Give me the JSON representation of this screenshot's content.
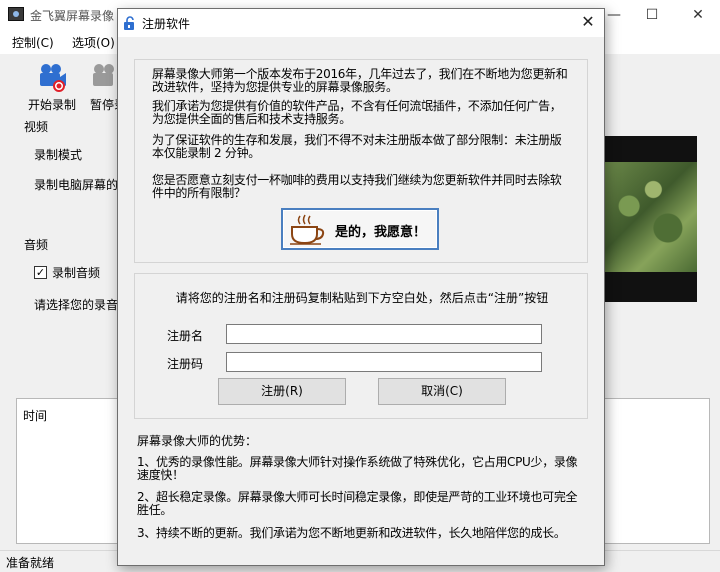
{
  "main_window": {
    "title": "金飞翼屏幕录像",
    "controls": {
      "minimize": "—",
      "maximize": "☐",
      "close": "✕"
    },
    "menu": [
      "控制(C)",
      "选项(O)"
    ],
    "toolbar": [
      {
        "label": "开始录制",
        "icon": "camera-record-icon"
      },
      {
        "label": "暂停录",
        "icon": "camera-pause-icon"
      }
    ],
    "video_section": "视频",
    "record_mode_label": "录制模式",
    "record_screen_label": "录制电脑屏幕的",
    "audio_section": "音频",
    "record_audio_label": "录制音频",
    "record_audio_checked": true,
    "select_audio_label": "请选择您的录音",
    "log_header": "时间",
    "status": "准备就绪"
  },
  "dialog": {
    "title": "注册软件",
    "close": "✕",
    "info": [
      "屏幕录像大师第一个版本发布于2016年，几年过去了，我们在不断地为您更新和改进软件，坚持为您提供专业的屏幕录像服务。",
      "我们承诺为您提供有价值的软件产品，不含有任何流氓插件，不添加任何广告，为您提供全面的售后和技术支持服务。",
      "为了保证软件的生存和发展，我们不得不对未注册版本做了部分限制：未注册版本仅能录制 2 分钟。",
      "您是否愿意立刻支付一杯咖啡的费用以支持我们继续为您更新软件并同时去除软件中的所有限制？"
    ],
    "pay_button": "是的，我愿意！",
    "reg_instruction": "请将您的注册名和注册码复制粘贴到下方空白处，然后点击“注册”按钮",
    "name_label": "注册名",
    "name_value": "",
    "code_label": "注册码",
    "code_value": "",
    "register_button": "注册(R)",
    "cancel_button": "取消(C)",
    "advantages_title": "屏幕录像大师的优势：",
    "advantages": [
      "1、优秀的录像性能。屏幕录像大师针对操作系统做了特殊优化，它占用CPU少，录像速度快！",
      "2、超长稳定录像。屏幕录像大师可长时间稳定录像，即使是严苛的工业环境也可完全胜任。",
      "3、持续不断的更新。我们承诺为您不断地更新和改进软件，长久地陪伴您的成长。"
    ]
  },
  "colors": {
    "accent": "#4a7fc0",
    "cup": "#8b4513",
    "record_red": "#e0202a"
  }
}
